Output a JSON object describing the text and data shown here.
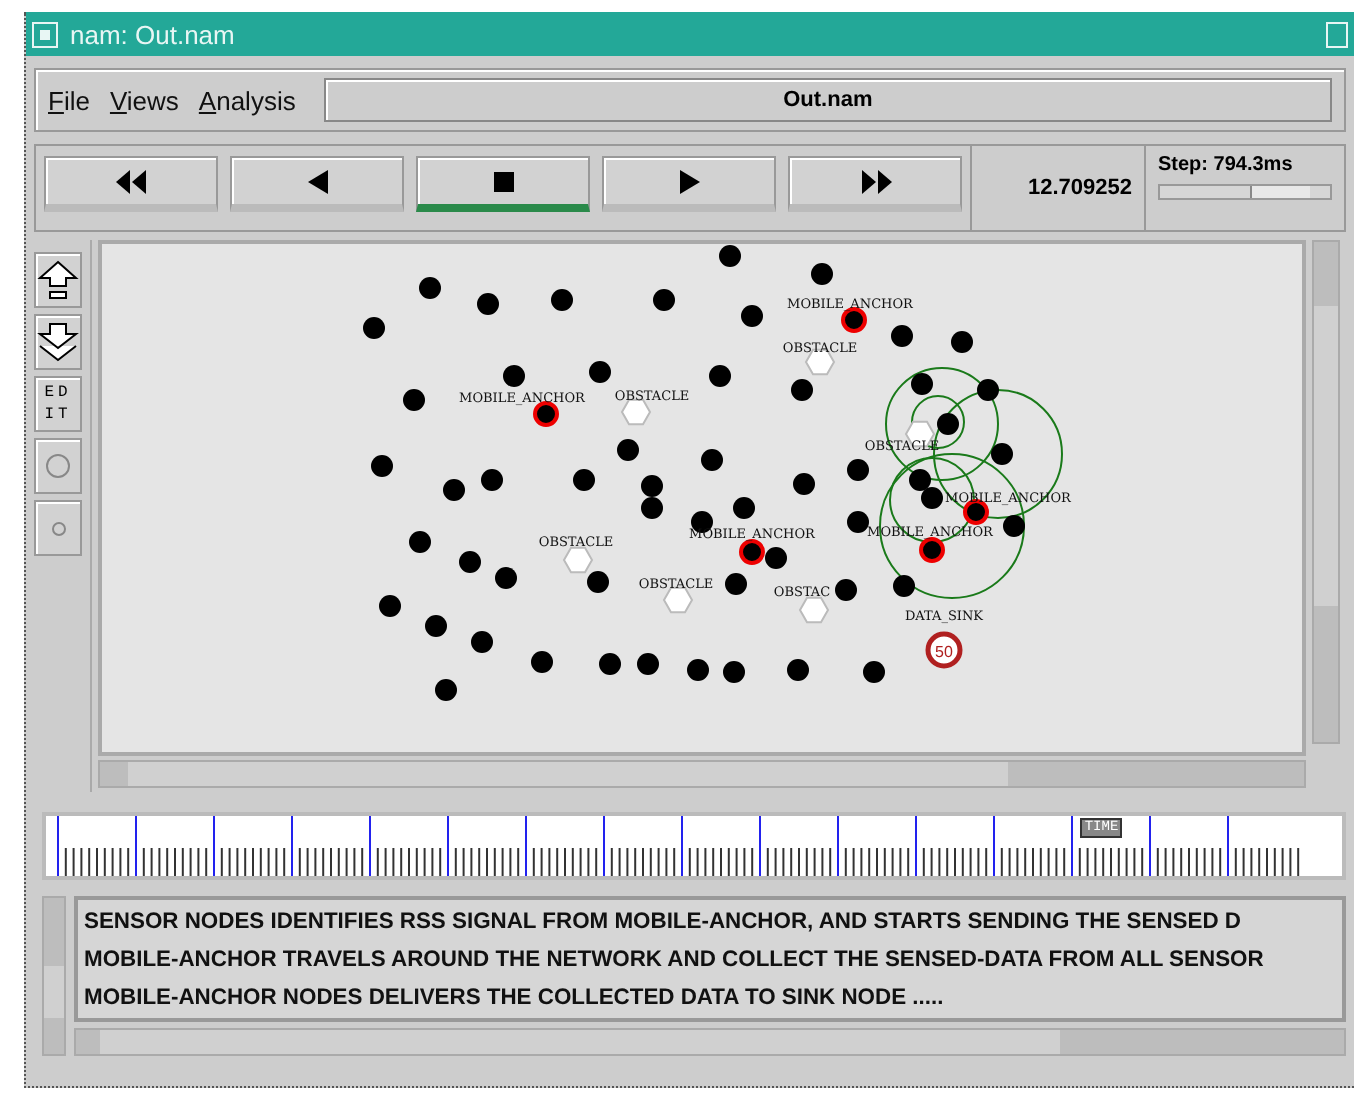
{
  "window": {
    "title": "nam: Out.nam"
  },
  "menu": [
    "File",
    "Views",
    "Analysis"
  ],
  "file_name": "Out.nam",
  "playback": [
    {
      "kind": "rewind",
      "selected": false
    },
    {
      "kind": "back",
      "selected": false
    },
    {
      "kind": "stop",
      "selected": true
    },
    {
      "kind": "play",
      "selected": false
    },
    {
      "kind": "forward",
      "selected": false
    }
  ],
  "time": "12.709252",
  "step": {
    "label": "Step: 794.3ms",
    "level": 0.88
  },
  "tools": [
    {
      "kind": "zoom-in"
    },
    {
      "kind": "zoom-out"
    },
    {
      "kind": "edit",
      "label": "EDIT"
    },
    {
      "kind": "circle-large"
    },
    {
      "kind": "circle-small"
    }
  ],
  "canvas": {
    "labeled_nodes": [
      {
        "kind": "anchor",
        "label": "MOBILE_ANCHOR"
      },
      {
        "kind": "anchor",
        "label": "MOBILE_ANCHOR"
      },
      {
        "kind": "anchor",
        "label": "MOBILE_ANCHOR"
      },
      {
        "kind": "anchor",
        "label": "MOBILE_ANCHOR"
      },
      {
        "kind": "anchor",
        "label": "MOBILE_ANCHOR"
      },
      {
        "kind": "obstacle",
        "label": "OBSTACLE"
      },
      {
        "kind": "obstacle",
        "label": "OBSTACLE"
      },
      {
        "kind": "obstacle",
        "label": "OBSTACLE"
      },
      {
        "kind": "obstacle",
        "label": "OBSTACLE"
      },
      {
        "kind": "obstacle",
        "label": "OBSTAC"
      },
      {
        "kind": "obstacle",
        "label": "OBSTACLE"
      },
      {
        "kind": "sink",
        "label": "DATA_SINK",
        "number": "50"
      }
    ]
  },
  "timeline": {
    "marker": "TIME",
    "level": 0.82
  },
  "log": [
    "SENSOR NODES IDENTIFIES RSS SIGNAL FROM MOBILE-ANCHOR, AND STARTS SENDING THE SENSED D",
    "MOBILE-ANCHOR TRAVELS AROUND THE NETWORK AND COLLECT THE SENSED-DATA FROM ALL SENSOR",
    "MOBILE-ANCHOR NODES DELIVERS THE COLLECTED DATA TO SINK NODE ....."
  ]
}
